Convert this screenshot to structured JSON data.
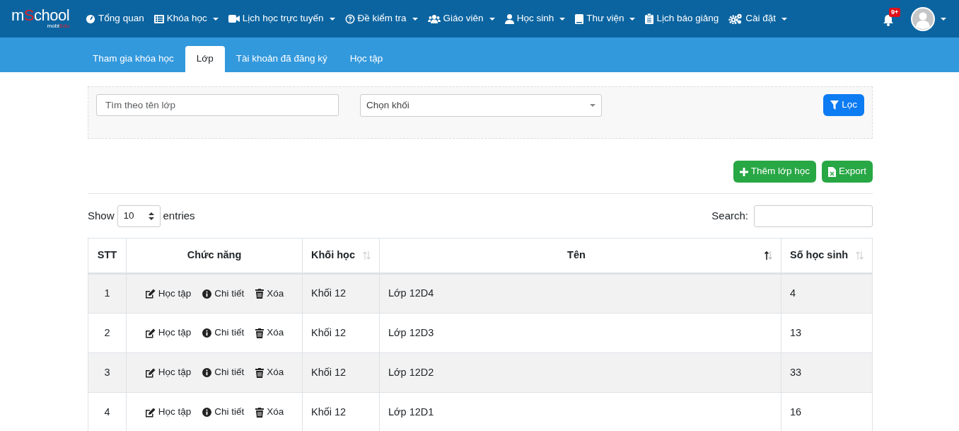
{
  "logo": {
    "prefix": "m",
    "highlight": "S",
    "suffix": "chool",
    "sub_prefix": "mobi",
    "sub_highlight": "Edu"
  },
  "nav": [
    {
      "label": "Tổng quan",
      "dropdown": false
    },
    {
      "label": "Khóa học",
      "dropdown": true
    },
    {
      "label": "Lịch học trực tuyến",
      "dropdown": true
    },
    {
      "label": "Đề kiểm tra",
      "dropdown": true
    },
    {
      "label": "Giáo viên",
      "dropdown": true
    },
    {
      "label": "Học sinh",
      "dropdown": true
    },
    {
      "label": "Thư viện",
      "dropdown": true
    },
    {
      "label": "Lịch báo giảng",
      "dropdown": false
    },
    {
      "label": "Cài đặt",
      "dropdown": true
    }
  ],
  "notification_badge": "9+",
  "tabs": [
    {
      "label": "Tham gia khóa học",
      "selected": false
    },
    {
      "label": "Lớp",
      "selected": true
    },
    {
      "label": "Tài khoản đã đăng ký",
      "selected": false
    },
    {
      "label": "Học tập",
      "selected": false
    }
  ],
  "filter": {
    "search_placeholder": "Tìm theo tên lớp",
    "grade_select": "Chọn khối",
    "filter_button": "Lọc"
  },
  "actions": [
    {
      "label": "Thêm lớp học"
    },
    {
      "label": "Export"
    }
  ],
  "length": {
    "show": "Show",
    "value": "10",
    "entries": "entries"
  },
  "search_label": "Search:",
  "table": {
    "columns": [
      {
        "label": "STT",
        "sortable": false
      },
      {
        "label": "Chức năng",
        "sortable": false
      },
      {
        "label": "Khối học",
        "sortable": true,
        "sorted": false
      },
      {
        "label": "Tên",
        "sortable": true,
        "sorted": true
      },
      {
        "label": "Số học sinh",
        "sortable": true,
        "sorted": false
      }
    ],
    "rows": [
      {
        "stt": "1",
        "actions": [
          "Học tập",
          "Chi tiết",
          "Xóa"
        ],
        "grade": "Khối 12",
        "name": "Lớp 12D4",
        "students": "4"
      },
      {
        "stt": "2",
        "actions": [
          "Học tập",
          "Chi tiết",
          "Xóa"
        ],
        "grade": "Khối 12",
        "name": "Lớp 12D3",
        "students": "13"
      },
      {
        "stt": "3",
        "actions": [
          "Học tập",
          "Chi tiết",
          "Xóa"
        ],
        "grade": "Khối 12",
        "name": "Lớp 12D2",
        "students": "33"
      },
      {
        "stt": "4",
        "actions": [
          "Học tập",
          "Chi tiết",
          "Xóa"
        ],
        "grade": "Khối 12",
        "name": "Lớp 12D1",
        "students": "16"
      }
    ]
  }
}
